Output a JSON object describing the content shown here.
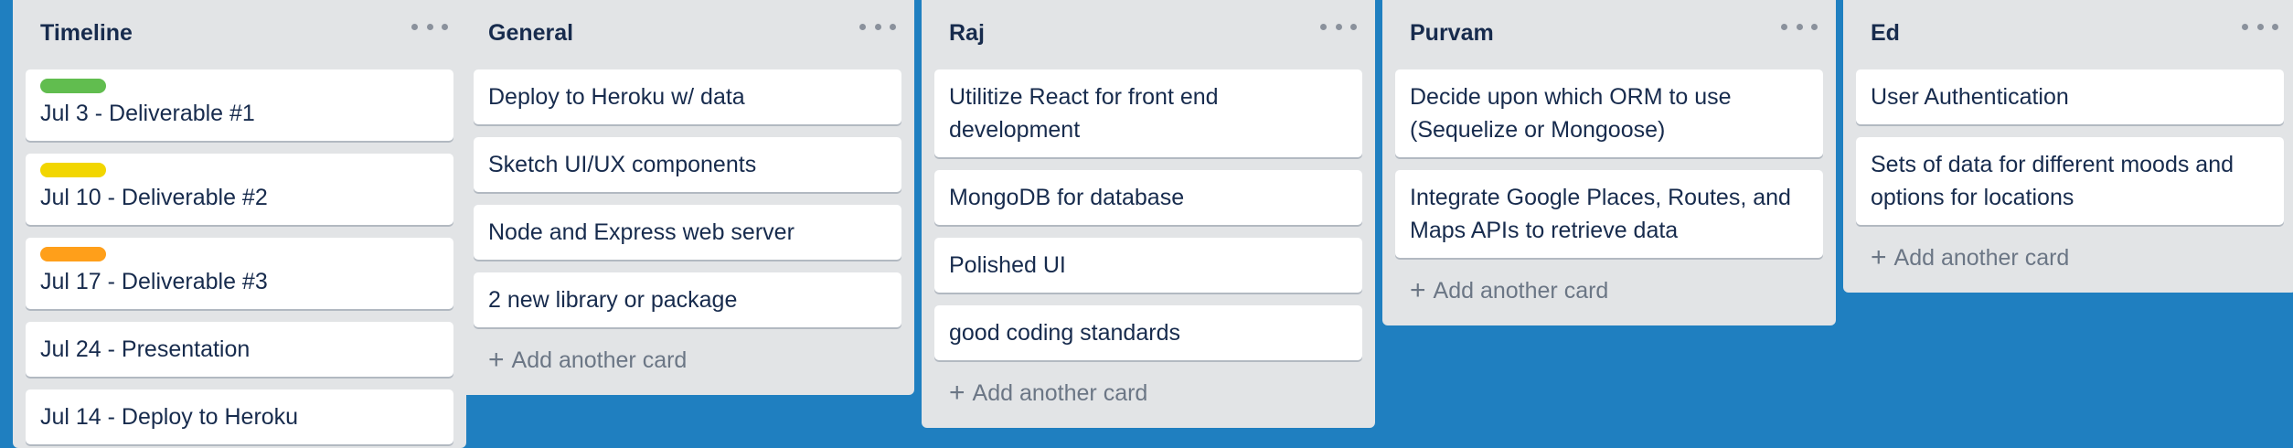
{
  "board": {
    "add_card_label": "Add another card",
    "lists": [
      {
        "title": "Timeline",
        "cards": [
          {
            "text": "Jul 3 - Deliverable #1",
            "label_color": "#61bd4f"
          },
          {
            "text": "Jul 10 - Deliverable #2",
            "label_color": "#f2d600"
          },
          {
            "text": "Jul 17 - Deliverable #3",
            "label_color": "#ff9f1a"
          },
          {
            "text": "Jul 24 - Presentation"
          },
          {
            "text": "Jul 14 - Deploy to Heroku"
          }
        ]
      },
      {
        "title": "General",
        "cards": [
          {
            "text": "Deploy to Heroku w/ data"
          },
          {
            "text": "Sketch UI/UX components"
          },
          {
            "text": "Node and Express web server"
          },
          {
            "text": "2 new library or package"
          }
        ]
      },
      {
        "title": "Raj",
        "cards": [
          {
            "text": "Utilitize React for front end development"
          },
          {
            "text": "MongoDB for database"
          },
          {
            "text": "Polished UI"
          },
          {
            "text": "good coding standards"
          }
        ]
      },
      {
        "title": "Purvam",
        "cards": [
          {
            "text": "Decide upon which ORM to use (Sequelize or Mongoose)"
          },
          {
            "text": "Integrate Google Places, Routes, and Maps APIs to retrieve data"
          }
        ]
      },
      {
        "title": "Ed",
        "cards": [
          {
            "text": "User Authentication"
          },
          {
            "text": "Sets of data for different moods and options for locations"
          }
        ]
      }
    ]
  },
  "colors": {
    "board_background": "#1f7fc0",
    "list_background": "#e2e4e6",
    "card_background": "#ffffff",
    "label_green": "#61bd4f",
    "label_yellow": "#f2d600",
    "label_orange": "#ff9f1a"
  },
  "icons": {
    "list_menu": "ellipsis-icon",
    "add_card": "plus-icon"
  }
}
